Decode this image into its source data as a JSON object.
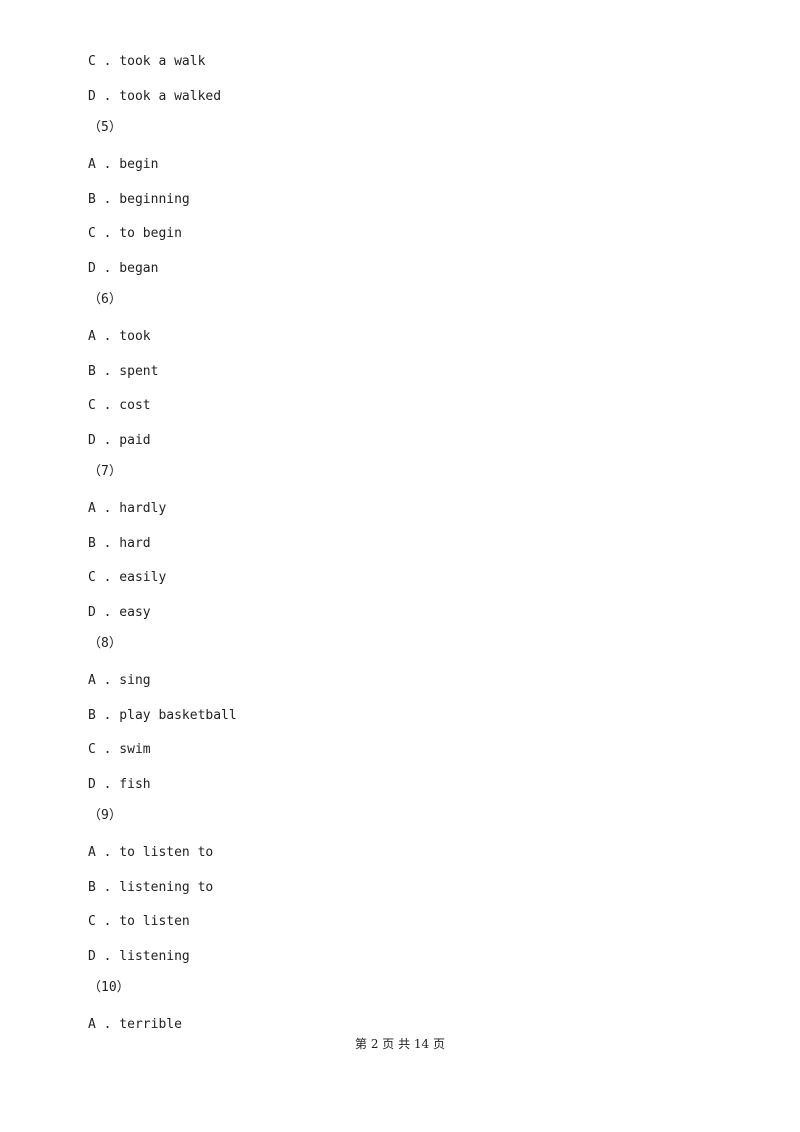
{
  "lines": [
    {
      "type": "option",
      "text": "C . took a walk"
    },
    {
      "type": "option",
      "text": "D . took a walked"
    },
    {
      "type": "question",
      "text": "（5）"
    },
    {
      "type": "option",
      "text": "A . begin"
    },
    {
      "type": "option",
      "text": "B . beginning"
    },
    {
      "type": "option",
      "text": "C . to begin"
    },
    {
      "type": "option",
      "text": "D . began"
    },
    {
      "type": "question",
      "text": "（6）"
    },
    {
      "type": "option",
      "text": "A . took"
    },
    {
      "type": "option",
      "text": "B . spent"
    },
    {
      "type": "option",
      "text": "C . cost"
    },
    {
      "type": "option",
      "text": "D . paid"
    },
    {
      "type": "question",
      "text": "（7）"
    },
    {
      "type": "option",
      "text": "A . hardly"
    },
    {
      "type": "option",
      "text": "B . hard"
    },
    {
      "type": "option",
      "text": "C . easily"
    },
    {
      "type": "option",
      "text": "D . easy"
    },
    {
      "type": "question",
      "text": "（8）"
    },
    {
      "type": "option",
      "text": "A . sing"
    },
    {
      "type": "option",
      "text": "B . play basketball"
    },
    {
      "type": "option",
      "text": "C . swim"
    },
    {
      "type": "option",
      "text": "D . fish"
    },
    {
      "type": "question",
      "text": "（9）"
    },
    {
      "type": "option",
      "text": "A . to listen to"
    },
    {
      "type": "option",
      "text": "B . listening to"
    },
    {
      "type": "option",
      "text": "C . to listen"
    },
    {
      "type": "option",
      "text": "D . listening"
    },
    {
      "type": "question",
      "text": "（10）"
    },
    {
      "type": "option",
      "text": "A . terrible"
    }
  ],
  "footer": "第 2 页 共 14 页"
}
